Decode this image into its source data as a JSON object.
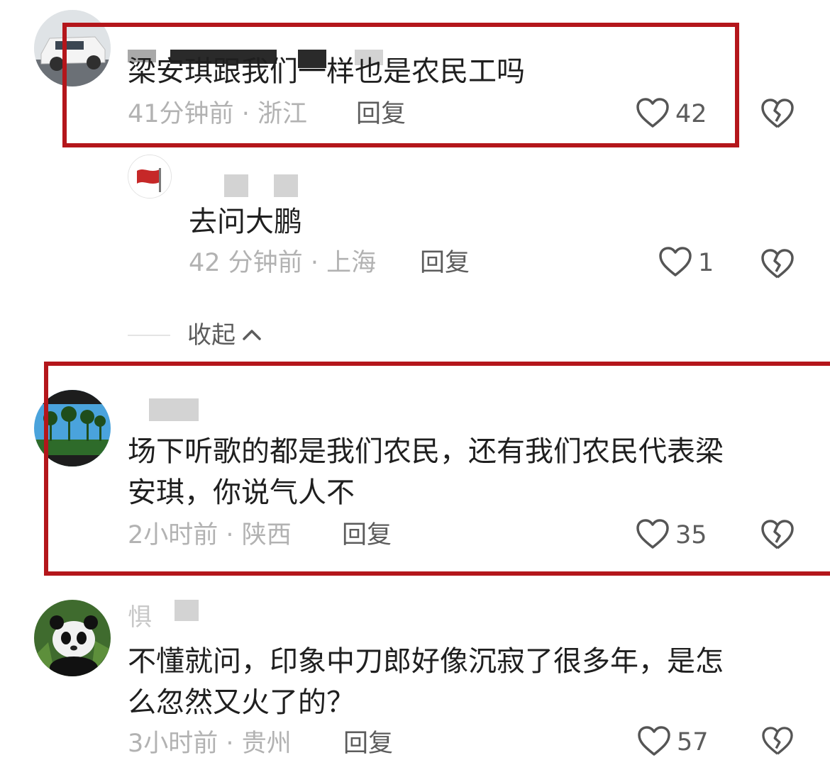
{
  "comments": [
    {
      "username_partial": "",
      "text_lines": [
        "梁安琪跟我们一样也是农民工吗"
      ],
      "time": "41分钟前",
      "location": "浙江",
      "reply_label": "回复",
      "likes": "42",
      "avatar_icon": "car-avatar-icon"
    },
    {
      "username_partial": "",
      "text_lines": [
        "去问大鹏"
      ],
      "time": "42 分钟前",
      "location": "上海",
      "reply_label": "回复",
      "likes": "1",
      "avatar_icon": "flag-avatar-icon"
    },
    {
      "username_partial": "",
      "text_lines": [
        "场下听歌的都是我们农民，还有我们农民代表梁",
        "安琪，你说气人不"
      ],
      "time": "2小时前",
      "location": "陕西",
      "reply_label": "回复",
      "likes": "35",
      "avatar_icon": "palm-trees-avatar-icon"
    },
    {
      "username_partial": "惧",
      "text_lines": [
        "不懂就问，印象中刀郎好像沉寂了很多年，是怎",
        "么忽然又火了的？"
      ],
      "time": "3小时前",
      "location": "贵州",
      "reply_label": "回复",
      "likes": "57",
      "avatar_icon": "panda-avatar-icon"
    }
  ],
  "collapse_label": "收起",
  "meta_separator": "·",
  "colors": {
    "highlight": "#b4161b",
    "meta": "#b2b2b2",
    "action": "#5c5c5c"
  }
}
